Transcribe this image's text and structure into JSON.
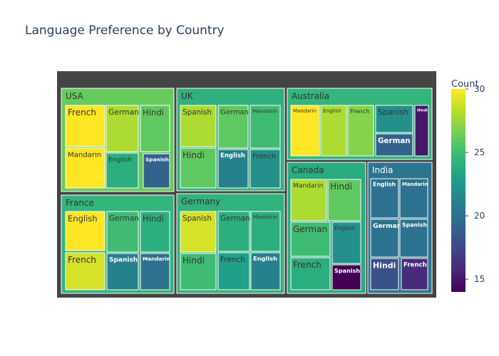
{
  "chart_data": {
    "type": "treemap",
    "title": "Language Preference by Country",
    "colorbar": {
      "title": "Count",
      "min": 14,
      "max": 30,
      "ticks": [
        15,
        20,
        25,
        30
      ]
    },
    "palette": [
      "#440154",
      "#482878",
      "#3e4989",
      "#31688e",
      "#26828e",
      "#1f9e89",
      "#35b779",
      "#6ece58",
      "#b5de2b",
      "#fde725"
    ],
    "background": "#444444",
    "countries": [
      {
        "name": "USA",
        "value": 26.2,
        "items": [
          {
            "label": "French",
            "value": 30
          },
          {
            "label": "Mandarin",
            "value": 30
          },
          {
            "label": "German",
            "value": 28
          },
          {
            "label": "English",
            "value": 24
          },
          {
            "label": "Hindi",
            "value": 26
          },
          {
            "label": "Spanish",
            "value": 19
          }
        ]
      },
      {
        "name": "UK",
        "value": 24.2,
        "items": [
          {
            "label": "Spanish",
            "value": 28
          },
          {
            "label": "Hindi",
            "value": 26
          },
          {
            "label": "German",
            "value": 26
          },
          {
            "label": "English",
            "value": 21
          },
          {
            "label": "Mandarin",
            "value": 25
          },
          {
            "label": "French",
            "value": 22
          }
        ]
      },
      {
        "name": "Australia",
        "value": 24.5,
        "items": [
          {
            "label": "Mandarin",
            "value": 30
          },
          {
            "label": "English",
            "value": 28
          },
          {
            "label": "French",
            "value": 27
          },
          {
            "label": "Spanish",
            "value": 22
          },
          {
            "label": "German",
            "value": 19
          },
          {
            "label": "Hindi",
            "value": 15
          }
        ]
      },
      {
        "name": "France",
        "value": 24.5,
        "items": [
          {
            "label": "English",
            "value": 30
          },
          {
            "label": "French",
            "value": 29
          },
          {
            "label": "German",
            "value": 25
          },
          {
            "label": "Spanish",
            "value": 21
          },
          {
            "label": "Hindi",
            "value": 24
          },
          {
            "label": "Mandarin",
            "value": 20
          }
        ]
      },
      {
        "name": "Germany",
        "value": 24.4,
        "items": [
          {
            "label": "Spanish",
            "value": 29
          },
          {
            "label": "Hindi",
            "value": 25
          },
          {
            "label": "German",
            "value": 24
          },
          {
            "label": "French",
            "value": 23
          },
          {
            "label": "Mandarin",
            "value": 24
          },
          {
            "label": "English",
            "value": 21
          }
        ]
      },
      {
        "name": "Canada",
        "value": 23.8,
        "items": [
          {
            "label": "Mandarin",
            "value": 28
          },
          {
            "label": "Hindi",
            "value": 26
          },
          {
            "label": "German",
            "value": 25
          },
          {
            "label": "French",
            "value": 24
          },
          {
            "label": "English",
            "value": 22
          },
          {
            "label": "Spanish",
            "value": 14
          }
        ]
      },
      {
        "name": "India",
        "value": 20.2,
        "items": [
          {
            "label": "English",
            "value": 20
          },
          {
            "label": "Mandarin",
            "value": 20
          },
          {
            "label": "German",
            "value": 20
          },
          {
            "label": "Spanish",
            "value": 20
          },
          {
            "label": "Hindi",
            "value": 18
          },
          {
            "label": "French",
            "value": 16
          }
        ]
      }
    ]
  }
}
